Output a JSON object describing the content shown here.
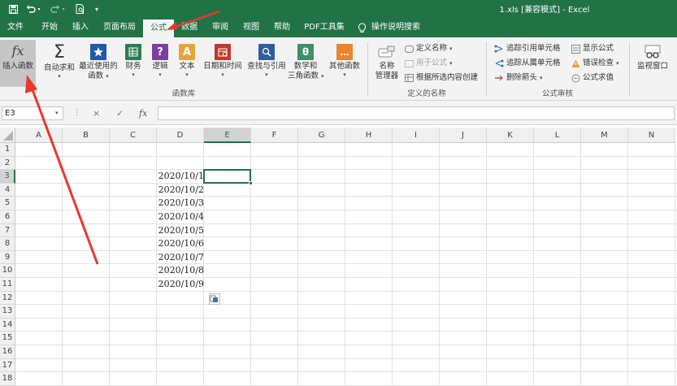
{
  "window": {
    "title": "1.xls  [兼容模式]  -  Excel"
  },
  "quick_access": {
    "save_icon": "save-icon",
    "undo_icon": "undo-icon",
    "redo_icon": "redo-icon",
    "preview_icon": "print-preview-icon"
  },
  "tabs": [
    {
      "label": "文件"
    },
    {
      "label": "开始"
    },
    {
      "label": "插入"
    },
    {
      "label": "页面布局"
    },
    {
      "label": "公式"
    },
    {
      "label": "数据"
    },
    {
      "label": "审阅"
    },
    {
      "label": "视图"
    },
    {
      "label": "帮助"
    },
    {
      "label": "PDF工具集"
    }
  ],
  "tell_me": {
    "label": "操作说明搜索"
  },
  "ribbon": {
    "function_library": {
      "group_label": "函数库",
      "insert_function": {
        "label": "插入函数",
        "icon": "fx"
      },
      "autosum": {
        "label1": "自动求和",
        "icon": "Σ"
      },
      "recent": {
        "label1": "最近使用的",
        "label2": "函数"
      },
      "financial": {
        "label1": "财务"
      },
      "logical": {
        "label1": "逻辑",
        "icon": "?"
      },
      "text": {
        "label1": "文本",
        "icon": "A"
      },
      "datetime": {
        "label1": "日期和时间"
      },
      "lookup": {
        "label1": "查找与引用"
      },
      "math": {
        "label1": "数学和",
        "label2": "三角函数",
        "icon": "θ"
      },
      "more": {
        "label1": "其他函数",
        "icon": "…"
      }
    },
    "defined_names": {
      "group_label": "定义的名称",
      "name_manager": {
        "label1": "名称",
        "label2": "管理器"
      },
      "define_name": {
        "label": "定义名称"
      },
      "use_in_formula": {
        "label": "用于公式"
      },
      "create_from_selection": {
        "label": "根据所选内容创建"
      }
    },
    "formula_auditing": {
      "group_label": "公式审核",
      "trace_precedents": {
        "label": "追踪引用单元格"
      },
      "trace_dependents": {
        "label": "追踪从属单元格"
      },
      "remove_arrows": {
        "label": "删除箭头"
      },
      "show_formulas": {
        "label": "显示公式"
      },
      "error_checking": {
        "label": "错误检查"
      },
      "evaluate_formula": {
        "label": "公式求值"
      },
      "watch_window": {
        "label": "监视窗口"
      }
    }
  },
  "formula_bar": {
    "name_box": "E3",
    "cancel_icon": "×",
    "enter_icon": "✓",
    "fx_icon": "fx",
    "formula": ""
  },
  "sheet": {
    "columns": [
      "A",
      "B",
      "C",
      "D",
      "E",
      "F",
      "G",
      "H",
      "I",
      "J",
      "K",
      "L",
      "M",
      "N"
    ],
    "rows": [
      "1",
      "2",
      "3",
      "4",
      "5",
      "6",
      "7",
      "8",
      "9",
      "10",
      "11",
      "12",
      "13",
      "14",
      "15",
      "16",
      "17",
      "18"
    ],
    "active_cell": "E3",
    "column_d_values": [
      {
        "row": 3,
        "value": "2020/10/1"
      },
      {
        "row": 4,
        "value": "2020/10/2"
      },
      {
        "row": 5,
        "value": "2020/10/3"
      },
      {
        "row": 6,
        "value": "2020/10/4"
      },
      {
        "row": 7,
        "value": "2020/10/5"
      },
      {
        "row": 8,
        "value": "2020/10/6"
      },
      {
        "row": 9,
        "value": "2020/10/7"
      },
      {
        "row": 10,
        "value": "2020/10/8"
      },
      {
        "row": 11,
        "value": "2020/10/9"
      }
    ]
  },
  "colors": {
    "brand_green": "#217346",
    "annotation_red": "#e8382e"
  }
}
